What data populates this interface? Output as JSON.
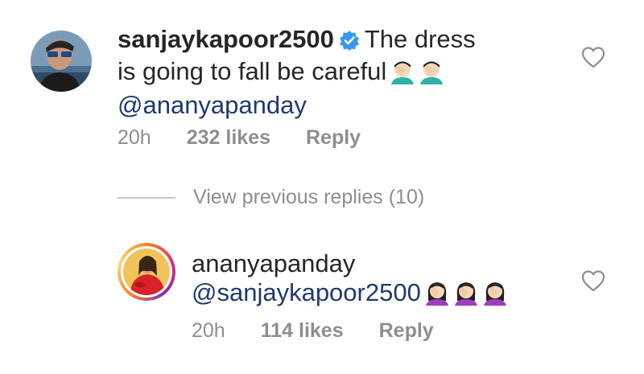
{
  "comments": [
    {
      "username": "sanjaykapoor2500",
      "verified": true,
      "text_line1": "The dress",
      "text_line2": "is going to fall be careful",
      "mention": "@ananyapanday",
      "time": "20h",
      "likes": "232 likes",
      "reply": "Reply",
      "emojis": [
        "facepalm-man-icon",
        "facepalm-man-icon"
      ]
    }
  ],
  "view_previous": "View previous replies (10)",
  "reply_comment": {
    "username": "ananyapanday",
    "mention": "@sanjaykapoor2500",
    "time": "20h",
    "likes": "114 likes",
    "reply": "Reply",
    "emojis": [
      "facepalm-woman-icon",
      "facepalm-woman-icon",
      "facepalm-woman-icon"
    ]
  },
  "colors": {
    "text": "#262626",
    "muted": "#8e8e8e",
    "mention": "#1e3a6e",
    "verified": "#3897f0"
  }
}
